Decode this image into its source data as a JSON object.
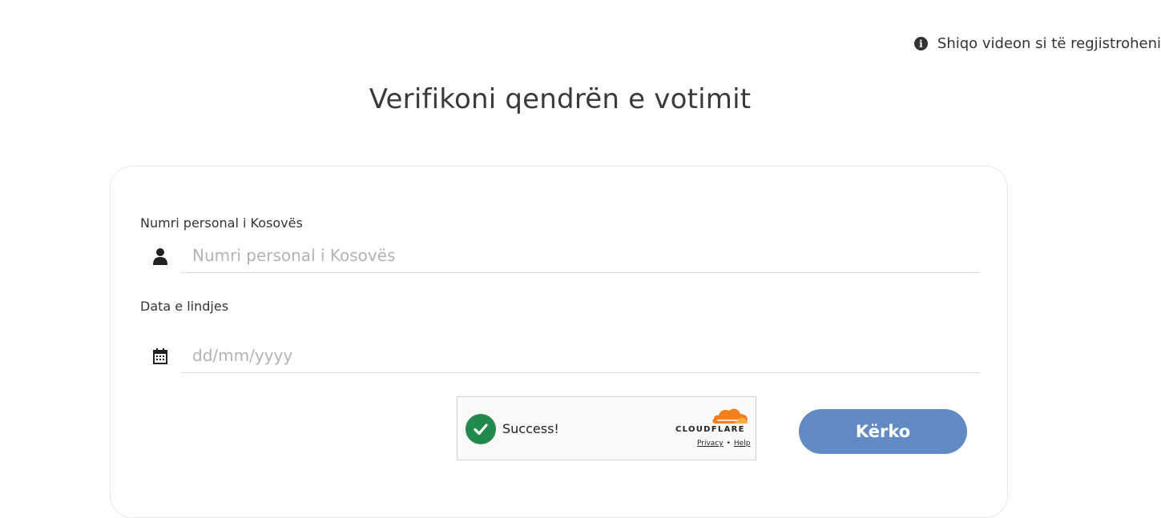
{
  "header": {
    "video_link_label": "Shiqo videon si të regjistroheni",
    "info_icon_glyph": "i"
  },
  "page": {
    "title": "Verifikoni qendrën e votimit"
  },
  "form": {
    "personal_id": {
      "label": "Numri personal i Kosovës",
      "placeholder": "Numri personal i Kosovës",
      "value": "",
      "icon": "user-icon"
    },
    "birth_date": {
      "label": "Data e lindjes",
      "placeholder": "dd/mm/yyyy",
      "value": "",
      "icon": "calendar-icon"
    },
    "captcha": {
      "status_text": "Success!",
      "provider": "CLOUDFLARE",
      "privacy_link": "Privacy",
      "separator": "•",
      "help_link": "Help",
      "success_color": "#1f8a4c",
      "brand_color": "#f38020"
    },
    "submit": {
      "label": "Kërko",
      "color": "#628bc4"
    }
  }
}
